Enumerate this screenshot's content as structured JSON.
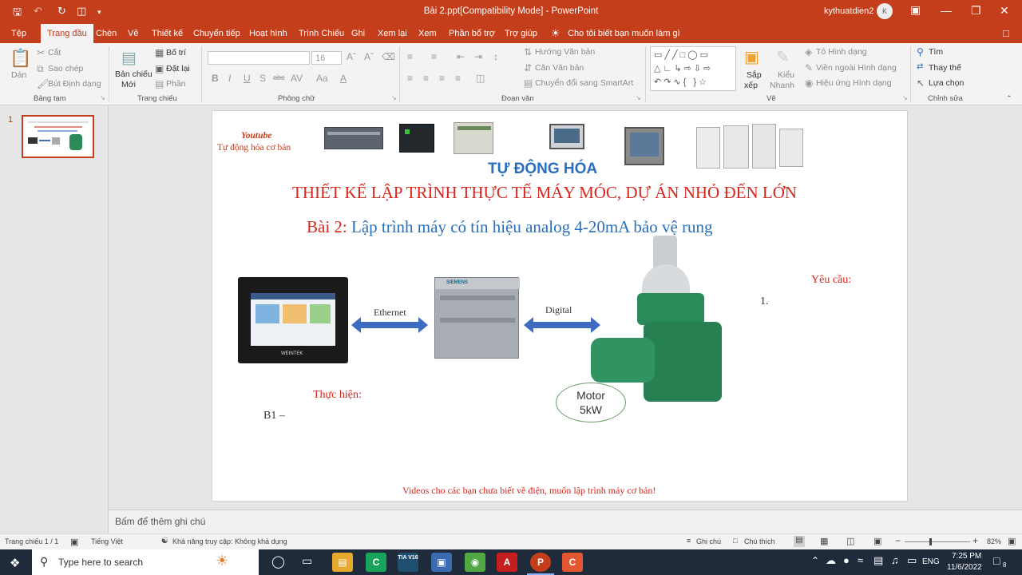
{
  "titlebar": {
    "title": "Bài 2.ppt[Compatibility Mode]  -  PowerPoint",
    "user": "kythuatdien2",
    "avatar_letter": "K",
    "qa_save_icon": "save-icon",
    "qa_undo_icon": "undo-icon",
    "qa_redo_icon": "redo-icon",
    "qa_present_icon": "present-icon"
  },
  "tabs": [
    "Tệp",
    "Trang đầu",
    "Chèn",
    "Vẽ",
    "Thiết kế",
    "Chuyển tiếp",
    "Hoạt hình",
    "Trình Chiếu",
    "Ghi",
    "Xem lại",
    "Xem",
    "Phần bổ trợ",
    "Trợ giúp"
  ],
  "active_tab": "Trang đầu",
  "tellme": "Cho tôi biết bạn muốn làm gì",
  "ribbon": {
    "clipboard": {
      "paste": "Dán",
      "cut": "Cắt",
      "copy": "Sao chép",
      "format_painter": "Bút Định dạng",
      "group": "Bảng tạm"
    },
    "slides": {
      "new_slide_1": "Bản chiếu",
      "new_slide_2": "Mới",
      "layout": "Bố trí",
      "reset": "Đặt lại",
      "section": "Phần",
      "group": "Trang chiếu"
    },
    "font": {
      "size": "16",
      "group": "Phông chữ",
      "bold": "B",
      "italic": "I",
      "underline": "U",
      "shadow": "S",
      "strike": "abc",
      "spacing": "AV",
      "case": "Aa",
      "color": "A"
    },
    "paragraph": {
      "text_direction": "Hướng Văn bản",
      "align_text": "Căn Văn bản",
      "smartart": "Chuyển đổi sang SmartArt",
      "group": "Đoạn văn"
    },
    "drawing": {
      "arrange_1": "Sắp",
      "arrange_2": "xếp",
      "quick_styles_1": "Kiểu",
      "quick_styles_2": "Nhanh",
      "shape_fill": "Tô Hình dạng",
      "shape_outline": "Viền ngoài Hình dạng",
      "shape_effects": "Hiệu ứng Hình dạng",
      "group": "Vẽ"
    },
    "editing": {
      "find": "Tìm",
      "replace": "Thay thế",
      "select": "Lựa chọn",
      "group": "Chỉnh sửa"
    }
  },
  "thumbnail_number": "1",
  "slide": {
    "youtube": "Youtube",
    "channel": "Tự động hóa cơ bản",
    "brand": "TỰ ĐỘNG HÓA",
    "heading": "THIẾT KẾ LẬP TRÌNH THỰC TẾ  MÁY MÓC, DỰ ÁN NHỎ ĐẾN LỚN",
    "lesson_prefix": "Bài 2: ",
    "lesson_title": "Lập trình máy có tín hiệu analog 4-20mA bảo vệ rung",
    "ethernet": "Ethernet",
    "digital": "Digital",
    "requirement": "Yêu cầu:",
    "req_number": "1.",
    "implementation": "Thực hiện:",
    "step": "B1 –",
    "motor_line1": "Motor",
    "motor_line2": "5kW",
    "footer": "Videos cho các bạn chưa biết về điện, muốn lập trình máy cơ bản!",
    "hmi_brand": "WEINTEK",
    "plc_brand": "SIEMENS",
    "colors": {
      "red": "#d9261c",
      "blue": "#2a6fbd",
      "arrow": "#3d6cc0",
      "motor_green": "#2a8a5a"
    }
  },
  "notes_placeholder": "Bấm để thêm ghi chú",
  "status": {
    "slide_count": "Trang chiếu 1 / 1",
    "language": "Tiếng Việt",
    "accessibility": "Khả năng truy cập: Không khả dụng",
    "notes": "Ghi chú",
    "comments": "Chú thích",
    "zoom": "82%"
  },
  "taskbar": {
    "search": "Type here to search",
    "lang": "ENG",
    "time": "7:25 PM",
    "date": "11/6/2022",
    "notif_count": "8",
    "tia_label": "TIA V16"
  }
}
